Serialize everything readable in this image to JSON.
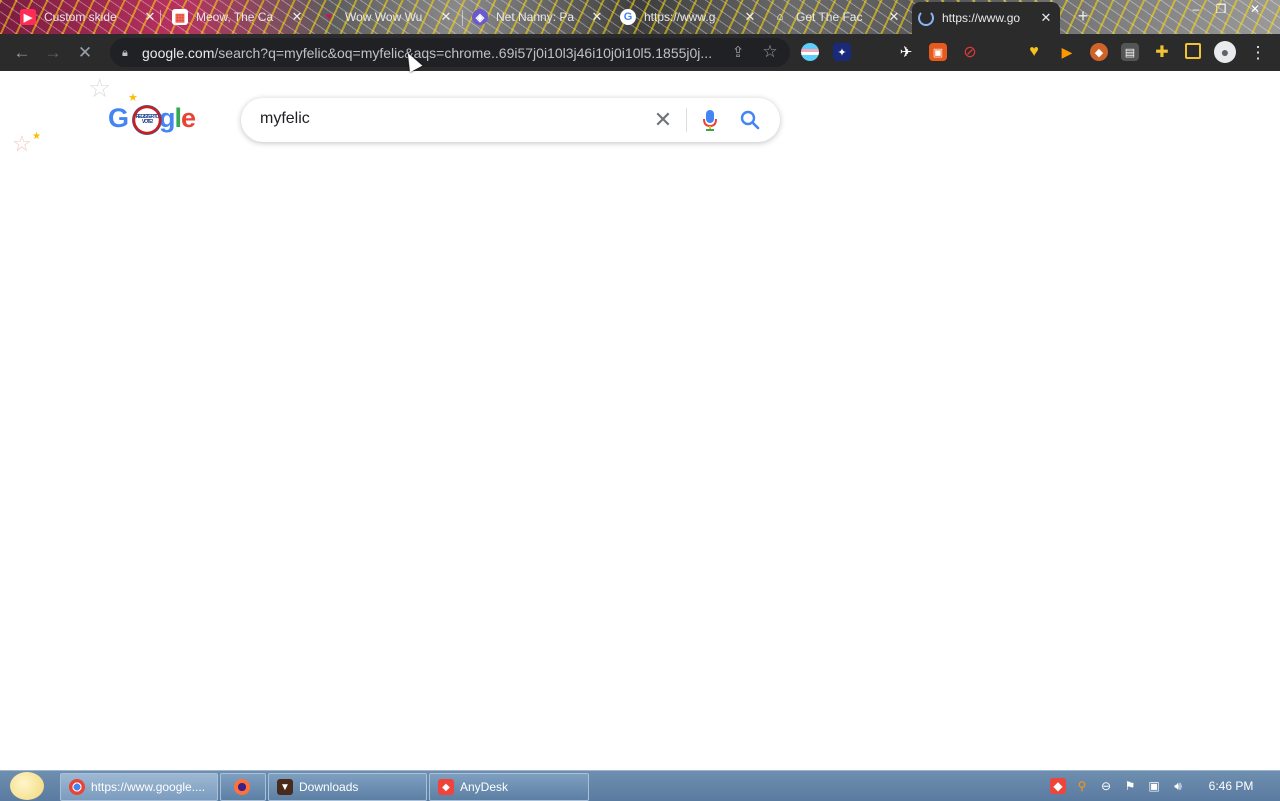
{
  "browser": {
    "tabs": [
      {
        "title": "Custom skide",
        "favicon": "play-icon",
        "color": "#ff2d55"
      },
      {
        "title": "Meow, The Ca",
        "favicon": "calendar-icon",
        "color": "#e94e3c"
      },
      {
        "title": "Wow Wow Wu",
        "favicon": "heart-icon",
        "color": "#c2185b"
      },
      {
        "title": "Net Nanny: Pa",
        "favicon": "shield-icon",
        "color": "#6a5acd"
      },
      {
        "title": "https://www.g",
        "favicon": "google-icon",
        "color": "#4285f4"
      },
      {
        "title": "Get The Fac",
        "favicon": "house-icon",
        "color": "#ffffff"
      },
      {
        "title": "https://www.go",
        "favicon": "loading-icon",
        "color": "#8ab4f8"
      }
    ],
    "new_tab": "+",
    "window_controls": [
      "–",
      "❐",
      "✕"
    ],
    "url_host": "google.com",
    "url_path": "/search?q=myfelic&oq=myfelic&aqs=chrome..69i57j0i10l3j46i10j0i10l5.1855j0j..."
  },
  "search": {
    "query": "myfelic",
    "clear_symbol": "✕",
    "logo_letters": [
      "G",
      "o",
      "o",
      "g",
      "l",
      "e"
    ],
    "doodle_text": "REGISTER TO VOTE!"
  },
  "taskbar": {
    "tasks": [
      {
        "label": "https://www.google....",
        "icon": "chrome-icon"
      },
      {
        "label": "",
        "icon": "firefox-icon"
      },
      {
        "label": "Downloads",
        "icon": "folder-icon"
      },
      {
        "label": "AnyDesk",
        "icon": "anydesk-icon"
      }
    ],
    "clock": "6:46 PM"
  },
  "colors": {
    "toolbar": "#2b2b2b",
    "omnibox": "#202124",
    "google_blue": "#4285f4",
    "google_red": "#ea4335",
    "google_yellow": "#fbbc05",
    "google_green": "#34a853",
    "taskbar": "#5a7ba0"
  }
}
